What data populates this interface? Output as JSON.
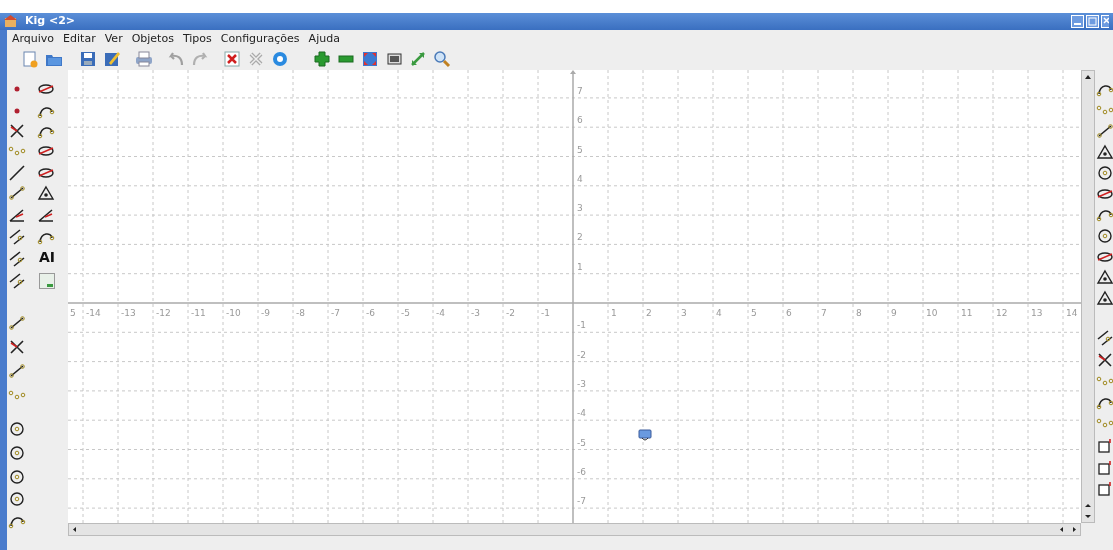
{
  "window": {
    "title": "Kig <2>"
  },
  "menu": [
    "Arquivo",
    "Editar",
    "Ver",
    "Objetos",
    "Tipos",
    "Configurações",
    "Ajuda"
  ],
  "tool_panel": {
    "text_tool_label": "AI"
  },
  "canvas": {
    "x_axis_labels": [
      "5",
      "-14",
      "-13",
      "-12",
      "-11",
      "-10",
      "-9",
      "-8",
      "-7",
      "-6",
      "-5",
      "-4",
      "-3",
      "-2",
      "-1",
      "1",
      "2",
      "3",
      "4",
      "5",
      "6",
      "7",
      "8",
      "9",
      "10",
      "11",
      "12",
      "13",
      "14"
    ],
    "y_axis_labels": [
      "7",
      "6",
      "5",
      "4",
      "3",
      "2",
      "1",
      "-1",
      "-2",
      "-3",
      "-4",
      "-5",
      "-6",
      "-7"
    ]
  }
}
